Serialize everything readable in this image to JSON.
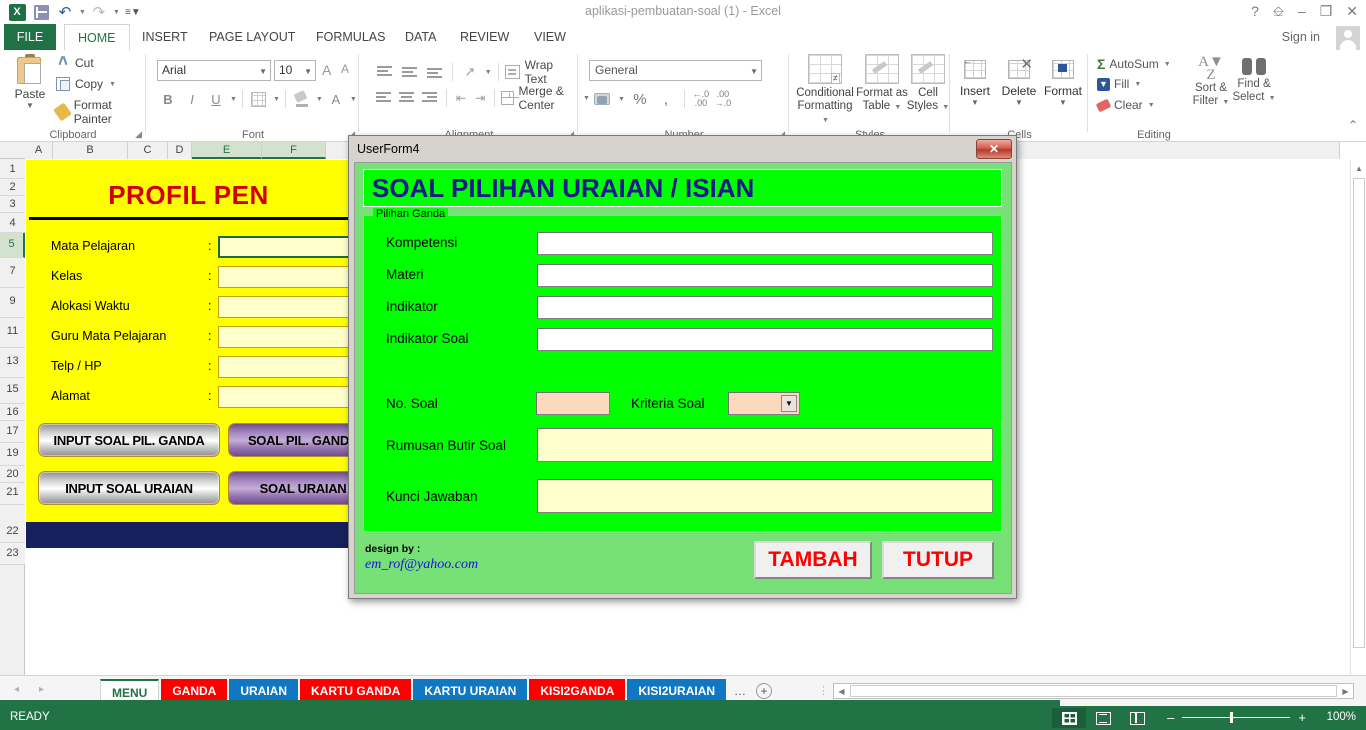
{
  "window": {
    "title": "aplikasi-pembuatan-soal (1) - Excel",
    "signin": "Sign in",
    "help_icon": "?",
    "ribbon_display_icon": "ribbon-display-options-icon",
    "minimize_icon": "–",
    "restore_icon": "❐",
    "close_icon": "✕"
  },
  "qat": {
    "logo": "X",
    "save_icon": "save-icon",
    "undo_icon": "↶",
    "redo_icon": "↷",
    "more_icon": "≡"
  },
  "ribbon": {
    "tabs": [
      {
        "label": "FILE",
        "active": false
      },
      {
        "label": "HOME",
        "active": true
      },
      {
        "label": "INSERT",
        "active": false
      },
      {
        "label": "PAGE LAYOUT",
        "active": false
      },
      {
        "label": "FORMULAS",
        "active": false
      },
      {
        "label": "DATA",
        "active": false
      },
      {
        "label": "REVIEW",
        "active": false
      },
      {
        "label": "VIEW",
        "active": false
      }
    ],
    "groups": {
      "clipboard": {
        "label": "Clipboard",
        "paste": "Paste",
        "cut": "Cut",
        "copy": "Copy",
        "format_painter": "Format Painter"
      },
      "font": {
        "label": "Font",
        "font_name": "Arial",
        "font_size": "10",
        "grow": "A",
        "shrink": "A",
        "bold": "B",
        "italic": "I",
        "underline": "U",
        "font_color": "A"
      },
      "alignment": {
        "label": "Alignment",
        "wrap_text": "Wrap Text",
        "merge_center": "Merge & Center"
      },
      "number": {
        "label": "Number",
        "format": "General",
        "percent": "%",
        "comma": ",",
        "inc_dec": ".00",
        "dec_dec": ".00"
      },
      "styles": {
        "label": "Styles",
        "conditional": "Conditional Formatting",
        "format_table": "Format as Table",
        "cell_styles": "Cell Styles"
      },
      "cells": {
        "label": "Cells",
        "insert": "Insert",
        "delete": "Delete",
        "format": "Format"
      },
      "editing": {
        "label": "Editing",
        "autosum": "AutoSum",
        "fill": "Fill",
        "clear": "Clear",
        "sort_filter": "Sort & Filter",
        "find_select": "Find & Select"
      }
    },
    "collapse_icon": "⌃"
  },
  "sheet": {
    "columns": [
      "A",
      "B",
      "C",
      "D",
      "E",
      "F"
    ],
    "rows": [
      "1",
      "2",
      "3",
      "4",
      "5",
      "7",
      "9",
      "11",
      "13",
      "15",
      "16",
      "17",
      "19",
      "20",
      "21",
      "22",
      "23"
    ],
    "panel_title": "PROFIL PEN",
    "fields": [
      {
        "label": "Mata Pelajaran",
        "colon": ":",
        "value": "",
        "active": true
      },
      {
        "label": "Kelas",
        "colon": ":",
        "value": "",
        "active": false
      },
      {
        "label": "Alokasi Waktu",
        "colon": ":",
        "value": "",
        "active": false
      },
      {
        "label": "Guru Mata Pelajaran",
        "colon": ":",
        "value": "",
        "active": false
      },
      {
        "label": "Telp / HP",
        "colon": ":",
        "value": "",
        "active": false
      },
      {
        "label": "Alamat",
        "colon": ":",
        "value": "",
        "active": false
      }
    ],
    "buttons": [
      {
        "label": "INPUT SOAL PIL. GANDA",
        "style": "silver"
      },
      {
        "label": "SOAL PIL. GANDA",
        "style": "purple"
      },
      {
        "label": "INPUT SOAL URAIAN",
        "style": "silver"
      },
      {
        "label": "SOAL URAIAN",
        "style": "purple"
      }
    ]
  },
  "sheet_tabs": {
    "prev_icon": "◂",
    "next_icon": "▸",
    "items": [
      {
        "label": "MENU",
        "color": "active"
      },
      {
        "label": "GANDA",
        "color": "red"
      },
      {
        "label": "URAIAN",
        "color": "blue"
      },
      {
        "label": "KARTU GANDA",
        "color": "red"
      },
      {
        "label": "KARTU URAIAN",
        "color": "blue"
      },
      {
        "label": "KISI2GANDA",
        "color": "red"
      },
      {
        "label": "KISI2URAIAN",
        "color": "blue"
      }
    ],
    "overflow": "…",
    "add_icon": "+"
  },
  "statusbar": {
    "ready": "READY",
    "view_normal_icon": "normal-view-icon",
    "view_layout_icon": "page-layout-view-icon",
    "view_pagebreak_icon": "page-break-view-icon",
    "zoom_out": "–",
    "zoom_in": "+",
    "zoom_value": "100%"
  },
  "dialog": {
    "title": "UserForm4",
    "close_icon": "✕",
    "header": "SOAL PILIHAN URAIAN / ISIAN",
    "frame_legend": "Pilihan Ganda",
    "fields": [
      {
        "label": "Kompetensi",
        "value": "",
        "type": "text"
      },
      {
        "label": "Materi",
        "value": "",
        "type": "text"
      },
      {
        "label": "Indikator",
        "value": "",
        "type": "text"
      },
      {
        "label": "Indikator Soal",
        "value": "",
        "type": "text"
      }
    ],
    "no_soal": {
      "label": "No. Soal",
      "value": ""
    },
    "kriteria_soal": {
      "label": "Kriteria Soal",
      "value": "",
      "caret": "▼"
    },
    "rumusan": {
      "label": "Rumusan Butir Soal",
      "value": ""
    },
    "kunci": {
      "label": "Kunci Jawaban",
      "value": ""
    },
    "design_by": "design by :",
    "design_email": "em_rof@yahoo.com",
    "btn_tambah": "TAMBAH",
    "btn_tutup": "TUTUP"
  },
  "colors": {
    "excel_green": "#217346",
    "bright_green": "#00ff00",
    "form_green": "#77e077",
    "navy_text": "#1a1a8c",
    "yellow": "#ffff00",
    "red": "#ff0000",
    "tab_blue": "#1077c3"
  }
}
